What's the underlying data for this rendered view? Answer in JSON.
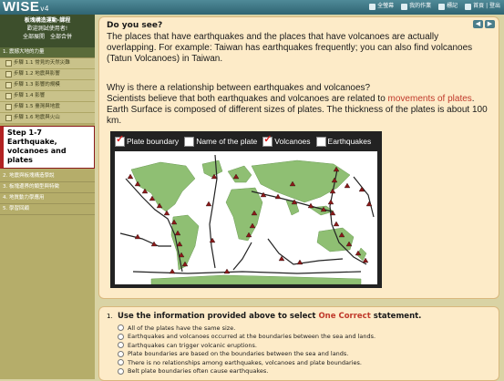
{
  "app": {
    "logo": "WISE",
    "version": "v4"
  },
  "toplinks": [
    {
      "label": "全螢幕",
      "icon": "fullscreen-icon"
    },
    {
      "label": "我的作業",
      "icon": "assignment-icon"
    },
    {
      "label": "標記",
      "icon": "flag-icon"
    },
    {
      "label": "首頁 | 登出",
      "icon": "home-icon"
    }
  ],
  "sidebar": {
    "title": "板塊構造運動-課程",
    "welcome": "歡迎測試使用者!",
    "expand_all": "全部展開",
    "collapse_all": "全部合併",
    "chapter1": "1. 震撼大地的力量",
    "steps": [
      "步驟 1.1 常見的天然災難",
      "步驟 1.2 地震與影響",
      "步驟 1.3 影響的規模",
      "步驟 1.4 影響",
      "步驟 1.5 臺灣與地震",
      "步驟 1.6 地震與火山"
    ],
    "active_step": "Step 1-7 Earthquake, volcanoes and plates",
    "chapters": [
      "2. 地震與板塊構造學說",
      "3. 板塊邊界的類型與特徵",
      "4. 地質動力學應用",
      "5. 學習回顧"
    ]
  },
  "content": {
    "heading": "Do you see?",
    "para1": "The places that have earthquakes and the places that have volcanoes are actually overlapping. For example: Taiwan has earthquakes frequently; you can also find volcanoes (Tatun Volcanoes) in Taiwan.",
    "para2_q": "Why is there a relationship between earthquakes and volcanoes?",
    "para2_a_pre": "Scientists believe that both earthquakes and volcanoes are related to ",
    "para2_a_link": "movements of plates",
    "para2_a_post": ".",
    "para2_b": "Earth Surface is composed of different sizes of plates. The thickness of the plates is about 100 km.",
    "legend": [
      {
        "label": "Plate boundary",
        "checked": true
      },
      {
        "label": "Name of the plate",
        "checked": false
      },
      {
        "label": "Volcanoes",
        "checked": true
      },
      {
        "label": "Earthquakes",
        "checked": false
      }
    ]
  },
  "question": {
    "number": "1.",
    "stem_pre": "Use the information provided above to select ",
    "stem_highlight": "One Correct",
    "stem_post": " statement.",
    "options": [
      "All of the plates have the same size.",
      "Earthquakes and volcanoes occurred at the boundaries between the sea and lands.",
      "Earthquakes can trigger volcanic eruptions.",
      "Plate boundaries are based on the boundaries between the sea and lands.",
      "There is no relationships among earthquakes, volcanoes and plate boundaries.",
      "Belt plate boundaries often cause earthquakes."
    ]
  },
  "colors": {
    "accent": "#c0392b",
    "topbar": "#2f6472",
    "panel": "#fdebc8",
    "sidebar": "#b5ad6a"
  }
}
